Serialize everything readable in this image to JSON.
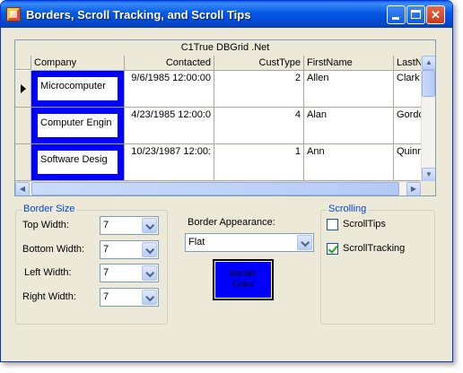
{
  "window": {
    "title": "Borders, Scroll Tracking, and Scroll Tips"
  },
  "grid": {
    "caption": "C1True DBGrid .Net",
    "columns": [
      "Company",
      "Contacted",
      "CustType",
      "FirstName",
      "LastN"
    ],
    "rows": [
      {
        "company": "Microcomputer",
        "contacted": "9/6/1985 12:00:00",
        "custtype": "2",
        "firstname": "Allen",
        "lastname": "Clark"
      },
      {
        "company": "Computer Engin",
        "contacted": "4/23/1985 12:00:0",
        "custtype": "4",
        "firstname": "Alan",
        "lastname": "Gordo"
      },
      {
        "company": "Software Desig",
        "contacted": "10/23/1987 12:00:",
        "custtype": "1",
        "firstname": "Ann",
        "lastname": "Quinn"
      }
    ],
    "border_color": "#0000ff"
  },
  "border_size": {
    "title": "Border Size",
    "top_label": "Top Width:",
    "top_value": "7",
    "bottom_label": "Bottom Width:",
    "bottom_value": "7",
    "left_label": "Left Width:",
    "left_value": "7",
    "right_label": "Right Width:",
    "right_value": "7"
  },
  "appearance": {
    "label": "Border Appearance:",
    "value": "Flat",
    "color_button_label": "Border\nColor"
  },
  "scrolling": {
    "title": "Scrolling",
    "scrolltips_label": "ScrollTips",
    "scrolltips_checked": false,
    "scrolltracking_label": "ScrollTracking",
    "scrolltracking_checked": true
  }
}
